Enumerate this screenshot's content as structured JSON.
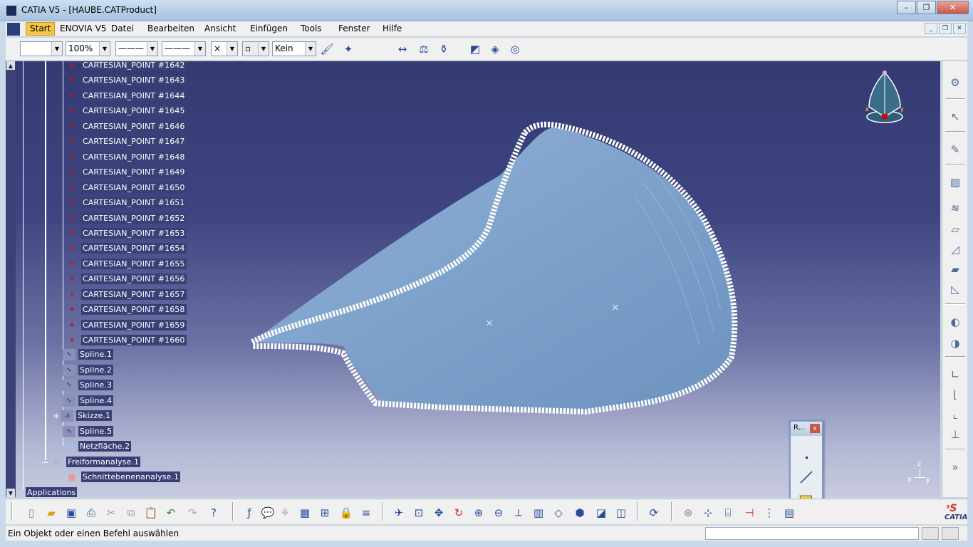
{
  "window": {
    "title": "CATIA V5 - [HAUBE.CATProduct]",
    "min_label": "–",
    "max_label": "❐",
    "close_label": "✕"
  },
  "menu": {
    "items": [
      "Start",
      "ENOVIA V5",
      "Datei",
      "Bearbeiten",
      "Ansicht",
      "Einfügen",
      "Tools",
      "Fenster",
      "Hilfe"
    ]
  },
  "graphic_props": {
    "color_value": "",
    "transparency_value": "100%",
    "linetype_value": "———",
    "linewidth_value": "———",
    "point_symbol_value": "×",
    "layer_label": "Kein"
  },
  "tree": {
    "points": [
      "CARTESIAN_POINT #1642",
      "CARTESIAN_POINT #1643",
      "CARTESIAN_POINT #1644",
      "CARTESIAN_POINT #1645",
      "CARTESIAN_POINT #1646",
      "CARTESIAN_POINT #1647",
      "CARTESIAN_POINT #1648",
      "CARTESIAN_POINT #1649",
      "CARTESIAN_POINT #1650",
      "CARTESIAN_POINT #1651",
      "CARTESIAN_POINT #1652",
      "CARTESIAN_POINT #1653",
      "CARTESIAN_POINT #1654",
      "CARTESIAN_POINT #1655",
      "CARTESIAN_POINT #1656",
      "CARTESIAN_POINT #1657",
      "CARTESIAN_POINT #1658",
      "CARTESIAN_POINT #1659",
      "CARTESIAN_POINT #1660"
    ],
    "splines": [
      "Spline.1",
      "Spline.2",
      "Spline.3",
      "Spline.4"
    ],
    "sketch": "Skizze.1",
    "spline5": "Spline.5",
    "net_surface": "Netzfläche.2",
    "freeform": "Freiformanalyse.1",
    "section": "Schnittebenenanalyse.1",
    "applications": "Applications"
  },
  "floating_toolbar": {
    "title": "R...",
    "close": "x"
  },
  "axis": {
    "x": "x",
    "y": "y",
    "z": "z"
  },
  "logo_text": "CATIA",
  "status": {
    "message": "Ein Objekt oder einen Befehl auswählen",
    "command_value": ""
  },
  "colors": {
    "background_top": "#353a72",
    "background_bottom": "#c8cbdf",
    "surface": "#7ea2cc",
    "start_highlight": "#f5c54a"
  }
}
